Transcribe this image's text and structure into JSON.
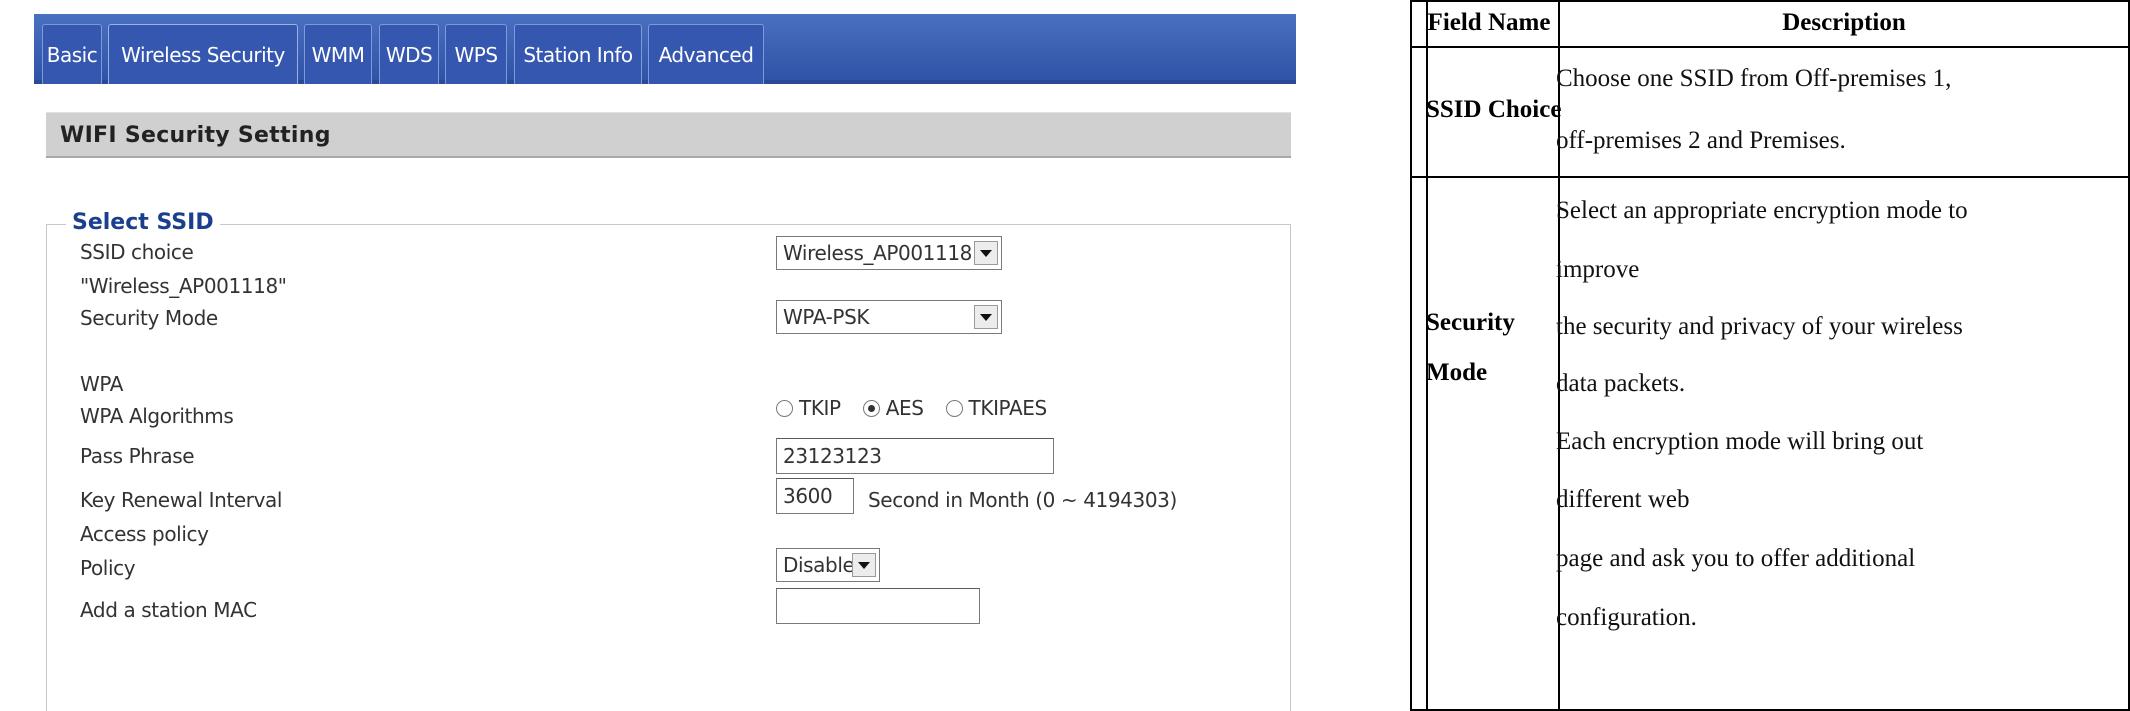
{
  "tabs": [
    "Basic",
    "Wireless Security",
    "WMM",
    "WDS",
    "WPS",
    "Station Info",
    "Advanced"
  ],
  "section_title": "WIFI Security Setting",
  "legend": "Select SSID",
  "labels": {
    "ssid_choice": "SSID choice",
    "ssid_name": "\"Wireless_AP001118\"",
    "security_mode": "Security Mode",
    "wpa": "WPA",
    "wpa_algorithms": "WPA Algorithms",
    "pass_phrase": "Pass Phrase",
    "key_renewal": "Key Renewal Interval",
    "access_policy": "Access policy",
    "policy": "Policy",
    "add_mac": "Add a station MAC"
  },
  "fields": {
    "ssid_choice_value": "Wireless_AP001118",
    "security_mode_value": "WPA-PSK",
    "pass_phrase_value": "23123123",
    "key_renewal_value": "3600",
    "key_renewal_hint": "Second in Month   (0 ~ 4194303)",
    "policy_value": "Disable",
    "add_mac_value": ""
  },
  "algorithms": [
    {
      "label": "TKIP",
      "selected": false
    },
    {
      "label": "AES",
      "selected": true
    },
    {
      "label": "TKIPAES",
      "selected": false
    }
  ],
  "table": {
    "headers": {
      "field": "Field Name",
      "description": "Description"
    },
    "row1": {
      "field": "SSID Choice",
      "lines": [
        "Choose one SSID from Off-premises 1,",
        "off-premises 2 and Premises."
      ]
    },
    "row2": {
      "field_lines": [
        "Security",
        "Mode"
      ],
      "lines": [
        "Select an appropriate encryption mode to",
        "improve",
        "the security and privacy of your wireless",
        "data packets.",
        "Each encryption mode will bring out",
        "different web",
        "page and ask you to offer additional",
        "configuration."
      ]
    }
  }
}
